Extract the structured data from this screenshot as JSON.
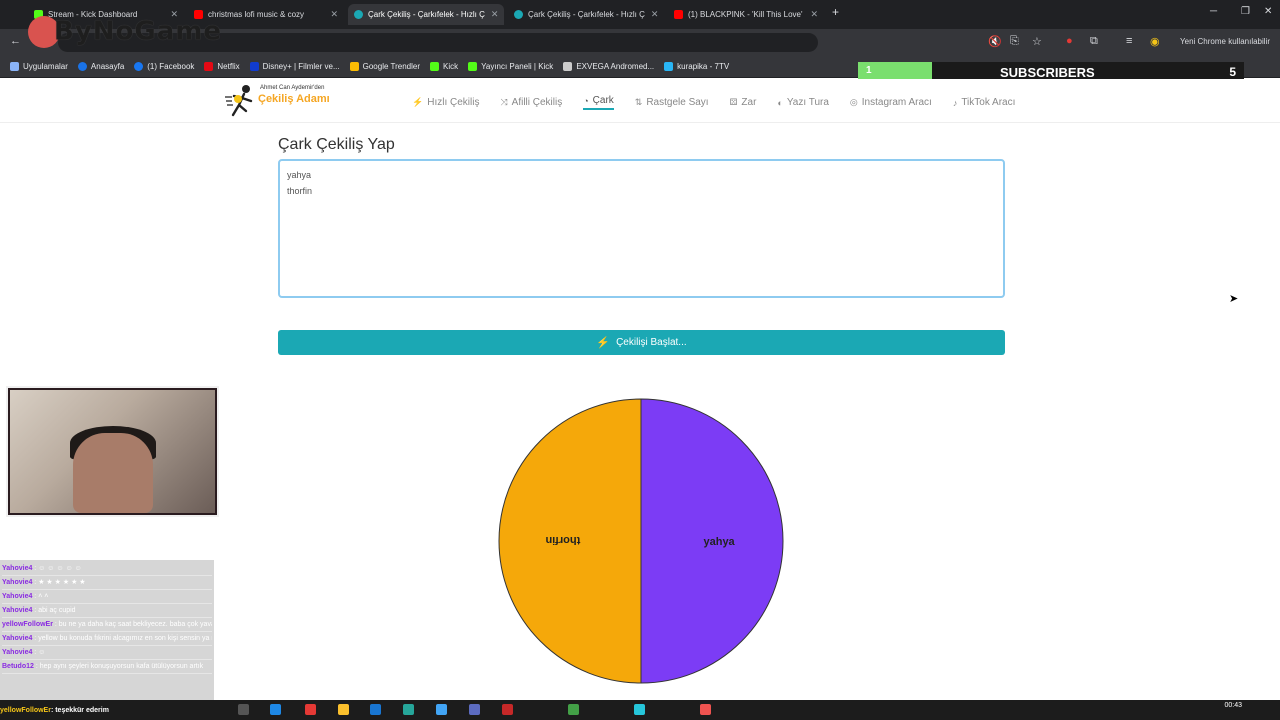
{
  "browser": {
    "tabs": [
      {
        "label": "Stream - Kick Dashboard",
        "favicon_color": "#53fc18"
      },
      {
        "label": "christmas lofi music & cozy",
        "favicon_color": "#ff0000"
      },
      {
        "label": "Çark Çekiliş - Çarkıfelek - Hızlı Ç",
        "favicon_color": "#1ba8b4"
      },
      {
        "label": "Çark Çekiliş - Çarkıfelek - Hızlı Ç",
        "favicon_color": "#1ba8b4"
      },
      {
        "label": "(1) BLACKPINK - 'Kill This Love'",
        "favicon_color": "#ff0000"
      }
    ],
    "new_tab": "+",
    "profile_text": "Yeni Chrome kullanılabilir",
    "overlay_logo": "ByNoGame",
    "bookmarks": [
      {
        "label": "Uygulamalar",
        "color": "#8ab4f8"
      },
      {
        "label": "Anasayfa",
        "color": "#1a73e8"
      },
      {
        "label": "(1) Facebook",
        "color": "#1877f2"
      },
      {
        "label": "Netflix",
        "color": "#e50914"
      },
      {
        "label": "Disney+ | Filmler ve...",
        "color": "#113ccf"
      },
      {
        "label": "Google Trendler",
        "color": "#fbbc04"
      },
      {
        "label": "Kick",
        "color": "#53fc18"
      },
      {
        "label": "Yayıncı Paneli | Kick",
        "color": "#53fc18"
      },
      {
        "label": "EXVEGA Andromed...",
        "color": "#cccccc"
      },
      {
        "label": "kurapika - 7TV",
        "color": "#29b6f6"
      }
    ],
    "subscribers_widget": {
      "current": "1",
      "label": "SUBSCRIBERS",
      "goal": "5"
    }
  },
  "site": {
    "logo_small": "Ahmet Can Aydemir'den",
    "logo_big": "Çekiliş Adamı",
    "nav": [
      {
        "label": "Hızlı Çekiliş",
        "icon": "⚡",
        "active": false
      },
      {
        "label": "Afilli Çekiliş",
        "icon": "⤨",
        "active": false
      },
      {
        "label": "Çark",
        "icon": "◔",
        "active": true
      },
      {
        "label": "Rastgele Sayı",
        "icon": "⇅",
        "active": false
      },
      {
        "label": "Zar",
        "icon": "⚄",
        "active": false
      },
      {
        "label": "Yazı Tura",
        "icon": "◐",
        "active": false
      },
      {
        "label": "Instagram Aracı",
        "icon": "◎",
        "active": false
      },
      {
        "label": "TikTok Aracı",
        "icon": "♪",
        "active": false
      }
    ],
    "page_title": "Çark Çekiliş Yap",
    "entries_text": "yahya\nthorfin",
    "start_button": "Çekilişi Başlat...",
    "wheel": {
      "segments": [
        {
          "label": "yahya",
          "color": "#7c3cf5"
        },
        {
          "label": "thorfin",
          "color": "#f5a80a"
        }
      ]
    }
  },
  "stream": {
    "chat": [
      {
        "user": "Yahovie4",
        "msg": ": ☺ ☺ ☺ ☺ ☺"
      },
      {
        "user": "Yahovie4",
        "msg": ": ★ ★ ★ ★ ★ ★"
      },
      {
        "user": "Yahovie4",
        "msg": ": ˄ ˄"
      },
      {
        "user": "Yahovie4",
        "msg": ": abi aç cupid"
      },
      {
        "user": "yellowFollowEr",
        "msg": ": bu ne ya daha kaç saat bekliyecez. baba çok yavaş yazıyorsun"
      },
      {
        "user": "Yahovie4",
        "msg": ": yellow bu konuda fıkrini alcagımız en son kişi sensin ya nolursun"
      },
      {
        "user": "Yahovie4",
        "msg": ": ☺"
      },
      {
        "user": "Betudo12",
        "msg": ": hep aynı şeyleri konuşuyorsun kafa ütülüyorsun artık"
      }
    ],
    "ticker_user": "yellowFollowEr",
    "ticker_msg": ": teşekkür ederim",
    "clock_time": "00:43"
  }
}
